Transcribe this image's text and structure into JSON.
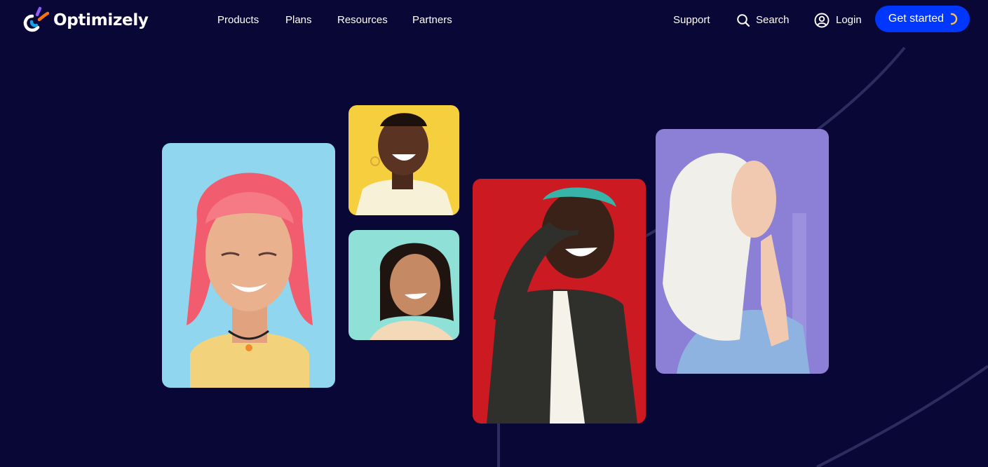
{
  "brand": {
    "name": "Optimizely",
    "logo_icon": "optimizely-logo-icon",
    "logo_colors": [
      "#ffffff",
      "#0ea5e9",
      "#8b5cf6",
      "#f97316"
    ]
  },
  "nav": {
    "links": [
      {
        "label": "Products"
      },
      {
        "label": "Plans"
      },
      {
        "label": "Resources"
      },
      {
        "label": "Partners"
      }
    ],
    "support_label": "Support",
    "search_label": "Search",
    "search_icon": "search-icon",
    "login_label": "Login",
    "login_icon": "user-circle-icon",
    "cta_label": "Get started",
    "cta_icon": "loading-spinner-icon"
  },
  "hero": {
    "photos": [
      {
        "name": "photo-woman-pink-hair",
        "background": "#8fd6ee"
      },
      {
        "name": "photo-woman-yellow-background",
        "background": "#f6cf3f"
      },
      {
        "name": "photo-woman-teal-background",
        "background": "#8fe0d6"
      },
      {
        "name": "photo-man-red-background",
        "background": "#cc1a22"
      },
      {
        "name": "photo-woman-purple-background",
        "background": "#8b7fd6"
      }
    ]
  },
  "colors": {
    "background": "#080736",
    "accent": "#0037ff",
    "spinner": "#f6c24a",
    "decorative_lines": "#2d2c5e"
  }
}
